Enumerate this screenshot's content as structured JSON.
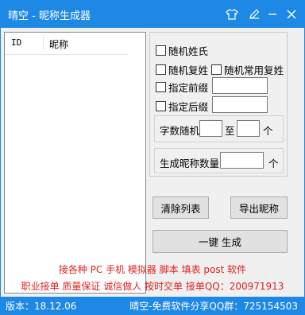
{
  "window": {
    "title": "晴空 - 昵称生成器"
  },
  "titlebar_icons": [
    "shirt-icon",
    "pencil-icon",
    "minimize-icon",
    "close-icon"
  ],
  "list": {
    "columns": [
      "ID",
      "昵称"
    ]
  },
  "options": {
    "random_surname": "随机姓氏",
    "random_double_surname": "随机复姓",
    "random_common_double_surname": "随机常用复姓",
    "prefix_label": "指定前缀",
    "prefix_value": "",
    "suffix_label": "指定后缀",
    "suffix_value": ""
  },
  "char_count": {
    "label": "字数随机",
    "to": "至",
    "unit": "个",
    "min": "",
    "max": ""
  },
  "generate_count": {
    "label": "生成昵称数量",
    "unit": "个",
    "value": ""
  },
  "buttons": {
    "clear": "清除列表",
    "export": "导出昵称",
    "generate": "一键 生成"
  },
  "promo": {
    "line1": "接各种 PC 手机 模拟器 脚本 填表 post 软件",
    "line2": "职业接单 质量保证 诚信做人 按时交单  接单QQ：200971913"
  },
  "status": {
    "version": "版本：18.12.06",
    "share": "晴空-免费软件分享QQ群：725154503"
  },
  "colors": {
    "accent": "#1e88e5",
    "promo": "#e02020"
  }
}
